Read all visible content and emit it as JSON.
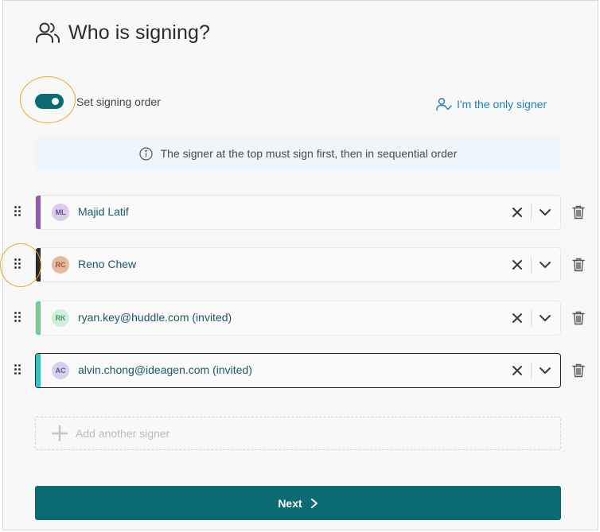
{
  "header": {
    "title": "Who is signing?",
    "icon": "users-icon"
  },
  "signing_order": {
    "label": "Set signing order",
    "enabled": true
  },
  "only_signer": {
    "label": "I'm the only signer",
    "icon": "user-check-icon"
  },
  "info_banner": {
    "text": "The signer at the top must sign first, then in sequential order",
    "icon": "info-icon"
  },
  "signers": [
    {
      "initials": "ML",
      "name": "Majid Latif",
      "stripe_color": "#8e5ea8",
      "avatar_bg": "#d9cdea",
      "avatar_fg": "#6b4c8f"
    },
    {
      "initials": "RC",
      "name": "Reno Chew",
      "stripe_color": "#2a2a2a",
      "avatar_bg": "#e8b89a",
      "avatar_fg": "#9a5b36"
    },
    {
      "initials": "RK",
      "name": "ryan.key@huddle.com (invited)",
      "stripe_color": "#7bc796",
      "avatar_bg": "#cfeedd",
      "avatar_fg": "#3f9a64"
    },
    {
      "initials": "AC",
      "name": "alvin.chong@ideagen.com (invited)",
      "stripe_color": "#2ec7c7",
      "avatar_bg": "#d6d2ee",
      "avatar_fg": "#5c52a8"
    }
  ],
  "add_signer": {
    "label": "Add another signer"
  },
  "next_button": {
    "label": "Next"
  },
  "colors": {
    "accent": "#0b6b72",
    "link": "#1f7fb5",
    "highlight_ring": "#f3a72a"
  }
}
